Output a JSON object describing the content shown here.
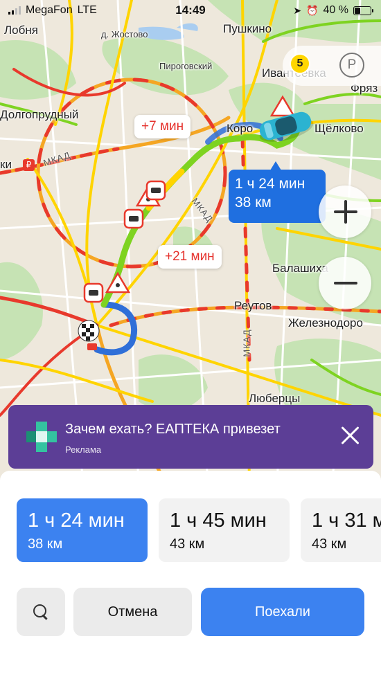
{
  "status_bar": {
    "carrier": "MegaFon",
    "network": "LTE",
    "time": "14:49",
    "battery": "40 %",
    "battery_level": 0.4
  },
  "map": {
    "places": {
      "lobnya": "Лобня",
      "zhostovo": "д. Жостово",
      "pushkino": "Пушкино",
      "pirogovsky": "Пироговский",
      "ivanteevka": "Ивантеевка",
      "fryazino": "Фряз",
      "dolgoprudny": "Долгопрудный",
      "korolev": "Коро",
      "schelkovo": "Щёлково",
      "khimki": "ки",
      "balashikha": "Балашиха",
      "reutov": "Реутов",
      "zheleznodorozhny": "Железнодоро",
      "lyubertsy": "Люберцы"
    },
    "road_labels": {
      "mkad_west": "МКАД",
      "mkad_north": "МКАД",
      "mkad_east": "МКАД"
    },
    "delay_bubbles": {
      "top": "+7 мин",
      "middle": "+21 мин"
    },
    "route_bubble": {
      "time": "1 ч 24 мин",
      "distance": "38 км"
    },
    "traffic_level": "5",
    "parking_label": "P",
    "colors": {
      "route_green": "#7ed321",
      "route_yellow": "#ffd400",
      "route_blue": "#2f6fd8",
      "traffic_red": "#e8392c",
      "bubble_blue": "#1f6fe0"
    }
  },
  "ad": {
    "title": "Зачем ехать? ЕАПТЕКА привезет",
    "subtitle": "Реклама",
    "background": "#5c3e96"
  },
  "routes": [
    {
      "time": "1 ч 24 мин",
      "distance": "38 км",
      "selected": true
    },
    {
      "time": "1 ч 45 мин",
      "distance": "43 км",
      "selected": false
    },
    {
      "time": "1 ч 31 м",
      "distance": "43 км",
      "selected": false
    }
  ],
  "buttons": {
    "cancel": "Отмена",
    "go": "Поехали"
  }
}
